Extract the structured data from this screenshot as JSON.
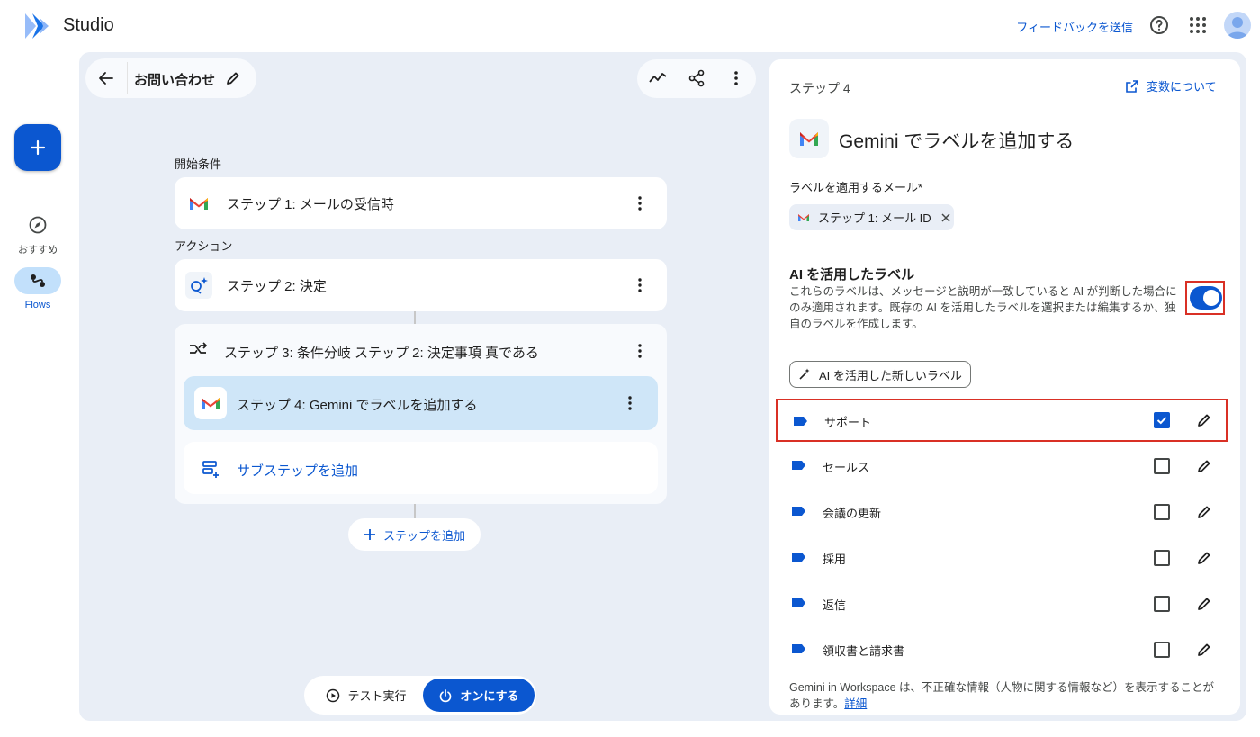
{
  "app": {
    "title": "Studio"
  },
  "header": {
    "feedback_label": "フィードバックを送信"
  },
  "rail": {
    "items": [
      {
        "label": "おすすめ"
      },
      {
        "label": "Flows"
      }
    ]
  },
  "flow": {
    "name": "お問い合わせ",
    "start_section": "開始条件",
    "action_section": "アクション",
    "steps": [
      {
        "label": "ステップ 1: メールの受信時"
      },
      {
        "label": "ステップ 2: 決定"
      },
      {
        "label": "ステップ 3: 条件分岐 ステップ 2: 決定事項 真である"
      },
      {
        "label": "ステップ 4: Gemini でラベルを追加する"
      }
    ],
    "add_substep_label": "サブステップを追加",
    "add_step_label": "ステップを追加",
    "test_run_label": "テスト実行",
    "turn_on_label": "オンにする"
  },
  "panel": {
    "step_heading": "ステップ 4",
    "variables_link": "変数について",
    "title": "Gemini でラベルを追加する",
    "email_field_label": "ラベルを適用するメール*",
    "email_chip": "ステップ 1: メール ID",
    "ai_section_title": "AI を活用したラベル",
    "ai_section_desc": "これらのラベルは、メッセージと説明が一致していると AI が判断した場合にのみ適用されます。既存の AI を活用したラベルを選択または編集するか、独自のラベルを作成します。",
    "ai_toggle_on": true,
    "new_label_button": "AI を活用した新しいラベル",
    "labels": [
      {
        "name": "サポート",
        "checked": true
      },
      {
        "name": "セールス",
        "checked": false
      },
      {
        "name": "会議の更新",
        "checked": false
      },
      {
        "name": "採用",
        "checked": false
      },
      {
        "name": "返信",
        "checked": false
      },
      {
        "name": "領収書と請求書",
        "checked": false
      }
    ],
    "disclaimer": "Gemini in Workspace は、不正確な情報（人物に関する情報など）を表示することがあります。",
    "disclaimer_link": "詳細"
  },
  "colors": {
    "accent": "#0b57d0",
    "canvas_bg": "#e9eef6",
    "highlight": "#d93025",
    "selected_step_bg": "#cfe6f8"
  }
}
